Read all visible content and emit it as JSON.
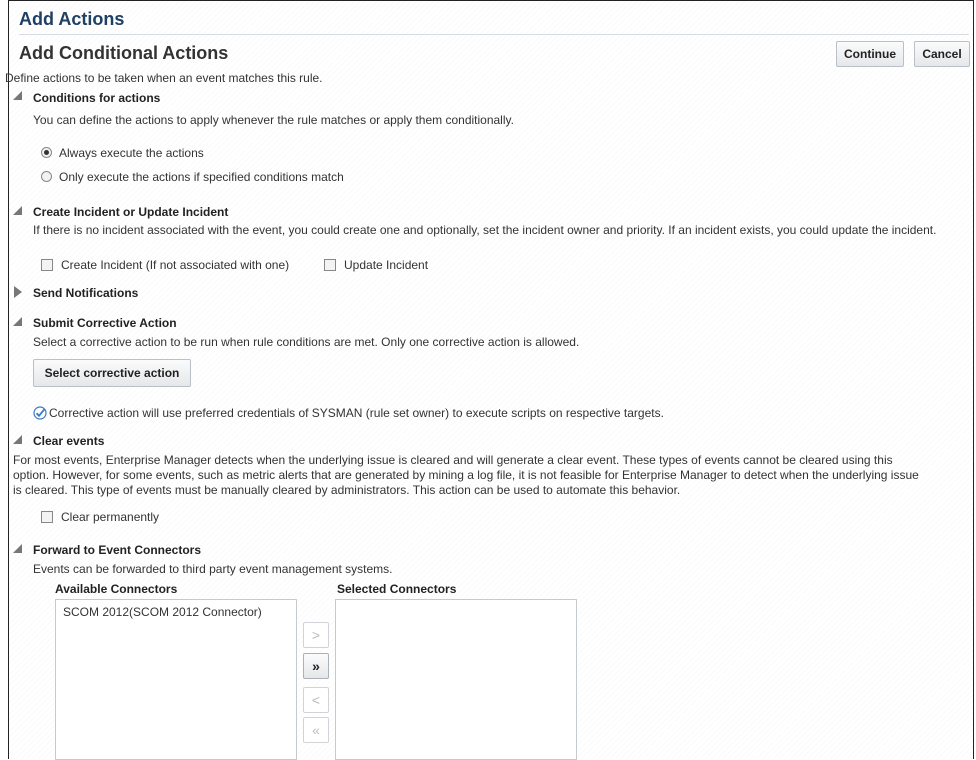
{
  "header": {
    "title": "Add Actions"
  },
  "page": {
    "title": "Add Conditional Actions",
    "description": "Define actions to be taken when an event matches this rule.",
    "continue_label": "Continue",
    "cancel_label": "Cancel"
  },
  "conditions": {
    "title": "Conditions for actions",
    "description": "You can define the actions to apply whenever the rule matches or apply them conditionally.",
    "options": [
      {
        "label": "Always execute the actions",
        "selected": true
      },
      {
        "label": "Only execute the actions if specified conditions match",
        "selected": false
      }
    ]
  },
  "incident": {
    "title": "Create Incident or Update Incident",
    "description": "If there is no incident associated with the event, you could create one and optionally, set the incident owner and priority. If an incident exists, you could update the incident.",
    "create_label": "Create Incident (If not associated with one)",
    "update_label": "Update Incident"
  },
  "notifications": {
    "title": "Send Notifications"
  },
  "corrective": {
    "title": "Submit Corrective Action",
    "description": "Select a corrective action to be run when rule conditions are met. Only one corrective action is allowed.",
    "button_label": "Select corrective action",
    "info": "Corrective action will use preferred credentials of SYSMAN (rule set owner) to execute scripts on respective targets."
  },
  "clear": {
    "title": "Clear events",
    "line1": "For most events, Enterprise Manager detects when the underlying issue is cleared and will generate a clear event. These types of events cannot be cleared using this",
    "line2": "option. However, for some events, such as metric alerts that are generated by mining a log file, it is not feasible for Enterprise Manager to detect when the underlying issue",
    "line3": "is cleared. This type of events must be manually cleared by administrators. This action can be used to automate this behavior.",
    "checkbox_label": "Clear permanently"
  },
  "forward": {
    "title": "Forward to Event Connectors",
    "description": "Events can be forwarded to third party event management systems.",
    "available_label": "Available Connectors",
    "selected_label": "Selected Connectors",
    "available_items": [
      "SCOM 2012(SCOM 2012 Connector)"
    ],
    "move_label": ">",
    "move_all_label": "»",
    "remove_label": "<",
    "remove_all_label": "«"
  }
}
